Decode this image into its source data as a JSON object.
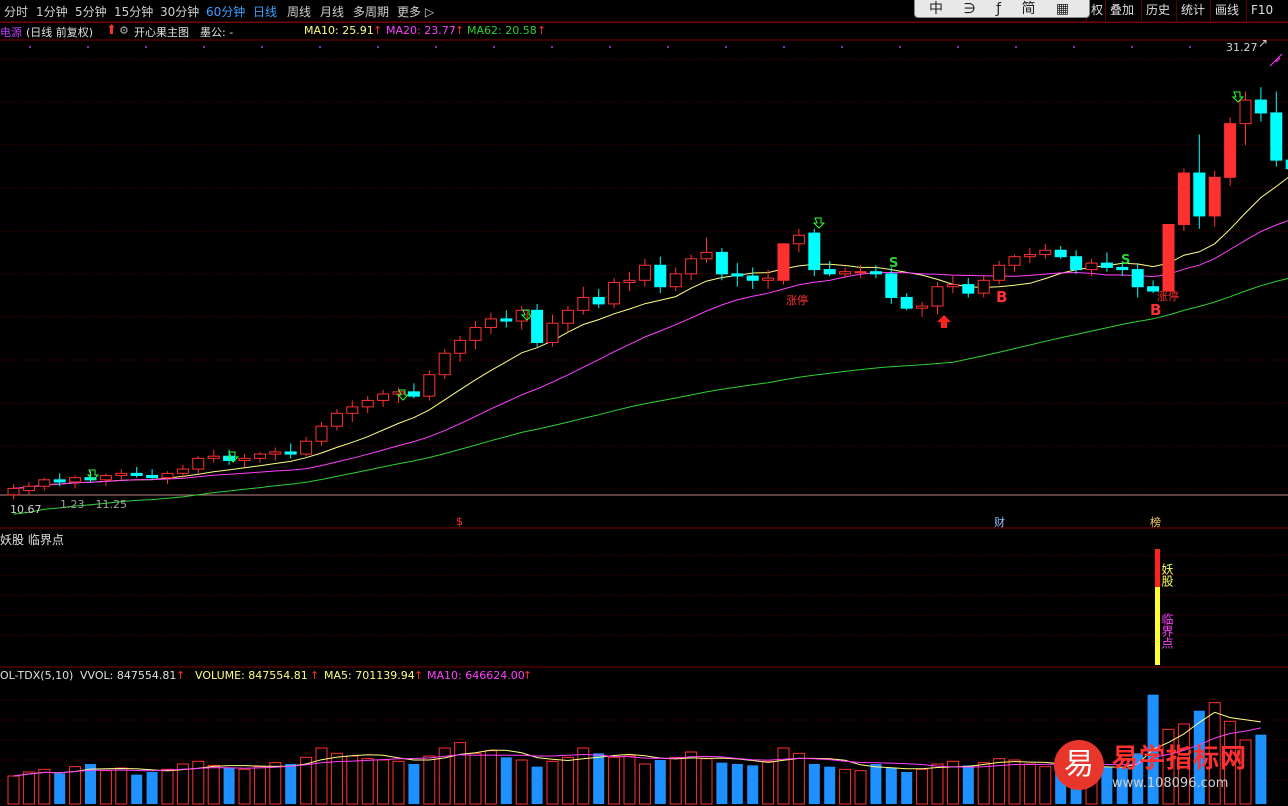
{
  "toolbar": {
    "periods": [
      "分时",
      "1分钟",
      "5分钟",
      "15分钟",
      "30分钟",
      "60分钟",
      "日线",
      "周线",
      "月线",
      "多周期",
      "更多 ▷"
    ],
    "active_index": 6,
    "right_buttons": [
      "权",
      "叠加",
      "历史",
      "统计",
      "画线",
      "F10"
    ],
    "popup_text": "中 ∋ ƒ 简 ▦"
  },
  "main_info": {
    "stock_name": "电源",
    "mode": "(日线 前复权)",
    "indicator_name": "开心果主图",
    "extra": "墨公: -",
    "ma10": "MA10: 25.91",
    "ma20": "MA20: 23.77",
    "ma62": "MA62: 20.58",
    "arrow_glyph": "↑"
  },
  "price_labels": {
    "high": "31.27",
    "low": "10.67",
    "range_note": "1.23 - 11.25"
  },
  "chart_markers": {
    "zt1": "涨停",
    "zt2": "涨停",
    "b1": "B",
    "b2": "B",
    "s1": "S",
    "s2": "S",
    "bottom_s": "$",
    "cai": "财",
    "bang": "榜"
  },
  "yaogu_panel": {
    "title": "妖股 临界点",
    "label_top": "妖股",
    "label_bottom": "临界点"
  },
  "volume_info": {
    "name": "OL-TDX(5,10)",
    "vvol": "VVOL: 847554.81",
    "volume": "VOLUME: 847554.81",
    "ma5": "MA5: 701139.94",
    "ma10": "MA10: 646624.00"
  },
  "watermark": {
    "logo": "易",
    "text": "易学指标网",
    "url": "www.108096.com"
  },
  "colors": {
    "up": "#ff3030",
    "down": "#00ffff",
    "ma10": "#ffff80",
    "ma20": "#ff40ff",
    "ma62": "#30d030",
    "volume_down": "#1e90ff",
    "grid": "#7a0000"
  },
  "chart_data": {
    "type": "candlestick",
    "x_count": 82,
    "ylim": [
      10.0,
      32.0
    ],
    "candles": [
      {
        "o": 10.8,
        "h": 11.3,
        "l": 10.6,
        "c": 11.1
      },
      {
        "o": 11.0,
        "h": 11.4,
        "l": 10.8,
        "c": 11.2
      },
      {
        "o": 11.2,
        "h": 11.6,
        "l": 11.0,
        "c": 11.5
      },
      {
        "o": 11.5,
        "h": 11.8,
        "l": 11.2,
        "c": 11.4
      },
      {
        "o": 11.4,
        "h": 11.7,
        "l": 11.1,
        "c": 11.6
      },
      {
        "o": 11.6,
        "h": 11.9,
        "l": 11.4,
        "c": 11.5
      },
      {
        "o": 11.5,
        "h": 11.8,
        "l": 11.2,
        "c": 11.7
      },
      {
        "o": 11.7,
        "h": 12.0,
        "l": 11.5,
        "c": 11.8
      },
      {
        "o": 11.8,
        "h": 12.1,
        "l": 11.6,
        "c": 11.7
      },
      {
        "o": 11.7,
        "h": 12.0,
        "l": 11.5,
        "c": 11.6
      },
      {
        "o": 11.6,
        "h": 11.9,
        "l": 11.3,
        "c": 11.8
      },
      {
        "o": 11.8,
        "h": 12.2,
        "l": 11.6,
        "c": 12.0
      },
      {
        "o": 12.0,
        "h": 12.6,
        "l": 11.8,
        "c": 12.5
      },
      {
        "o": 12.5,
        "h": 12.9,
        "l": 12.3,
        "c": 12.6
      },
      {
        "o": 12.6,
        "h": 12.9,
        "l": 12.2,
        "c": 12.4
      },
      {
        "o": 12.4,
        "h": 12.7,
        "l": 12.1,
        "c": 12.5
      },
      {
        "o": 12.5,
        "h": 12.8,
        "l": 12.3,
        "c": 12.7
      },
      {
        "o": 12.7,
        "h": 13.0,
        "l": 12.4,
        "c": 12.8
      },
      {
        "o": 12.8,
        "h": 13.2,
        "l": 12.5,
        "c": 12.7
      },
      {
        "o": 12.7,
        "h": 13.5,
        "l": 12.6,
        "c": 13.3
      },
      {
        "o": 13.3,
        "h": 14.2,
        "l": 13.1,
        "c": 14.0
      },
      {
        "o": 14.0,
        "h": 14.8,
        "l": 13.8,
        "c": 14.6
      },
      {
        "o": 14.6,
        "h": 15.2,
        "l": 14.2,
        "c": 14.9
      },
      {
        "o": 14.9,
        "h": 15.4,
        "l": 14.6,
        "c": 15.2
      },
      {
        "o": 15.2,
        "h": 15.7,
        "l": 14.9,
        "c": 15.5
      },
      {
        "o": 15.5,
        "h": 15.8,
        "l": 15.1,
        "c": 15.6
      },
      {
        "o": 15.6,
        "h": 16.0,
        "l": 15.3,
        "c": 15.4
      },
      {
        "o": 15.4,
        "h": 16.6,
        "l": 15.2,
        "c": 16.4
      },
      {
        "o": 16.4,
        "h": 17.6,
        "l": 16.2,
        "c": 17.4
      },
      {
        "o": 17.4,
        "h": 18.2,
        "l": 17.0,
        "c": 18.0
      },
      {
        "o": 18.0,
        "h": 18.9,
        "l": 17.6,
        "c": 18.6
      },
      {
        "o": 18.6,
        "h": 19.3,
        "l": 18.3,
        "c": 19.0
      },
      {
        "o": 19.0,
        "h": 19.4,
        "l": 18.6,
        "c": 18.9
      },
      {
        "o": 18.9,
        "h": 19.6,
        "l": 18.5,
        "c": 19.4
      },
      {
        "o": 19.4,
        "h": 19.7,
        "l": 17.7,
        "c": 17.9
      },
      {
        "o": 17.9,
        "h": 19.2,
        "l": 17.7,
        "c": 18.8
      },
      {
        "o": 18.8,
        "h": 19.6,
        "l": 18.4,
        "c": 19.4
      },
      {
        "o": 19.4,
        "h": 20.5,
        "l": 19.2,
        "c": 20.0
      },
      {
        "o": 20.0,
        "h": 20.4,
        "l": 19.5,
        "c": 19.7
      },
      {
        "o": 19.7,
        "h": 20.9,
        "l": 19.5,
        "c": 20.7
      },
      {
        "o": 20.7,
        "h": 21.2,
        "l": 20.3,
        "c": 20.8
      },
      {
        "o": 20.8,
        "h": 21.8,
        "l": 20.5,
        "c": 21.5
      },
      {
        "o": 21.5,
        "h": 21.9,
        "l": 20.2,
        "c": 20.5
      },
      {
        "o": 20.5,
        "h": 21.4,
        "l": 20.3,
        "c": 21.1
      },
      {
        "o": 21.1,
        "h": 22.0,
        "l": 20.8,
        "c": 21.8
      },
      {
        "o": 21.8,
        "h": 22.8,
        "l": 21.6,
        "c": 22.1
      },
      {
        "o": 22.1,
        "h": 22.3,
        "l": 20.8,
        "c": 21.1
      },
      {
        "o": 21.1,
        "h": 21.6,
        "l": 20.5,
        "c": 21.0
      },
      {
        "o": 21.0,
        "h": 21.4,
        "l": 20.4,
        "c": 20.8
      },
      {
        "o": 20.8,
        "h": 21.3,
        "l": 20.4,
        "c": 20.9
      },
      {
        "o": 20.8,
        "h": 22.5,
        "l": 20.6,
        "c": 22.5
      },
      {
        "o": 22.5,
        "h": 23.2,
        "l": 22.1,
        "c": 22.9
      },
      {
        "o": 23.0,
        "h": 23.2,
        "l": 21.0,
        "c": 21.3
      },
      {
        "o": 21.3,
        "h": 21.7,
        "l": 21.0,
        "c": 21.1
      },
      {
        "o": 21.1,
        "h": 21.4,
        "l": 20.9,
        "c": 21.2
      },
      {
        "o": 21.2,
        "h": 21.5,
        "l": 20.9,
        "c": 21.2
      },
      {
        "o": 21.2,
        "h": 21.5,
        "l": 20.9,
        "c": 21.1
      },
      {
        "o": 21.1,
        "h": 21.4,
        "l": 19.7,
        "c": 20.0
      },
      {
        "o": 20.0,
        "h": 20.2,
        "l": 19.4,
        "c": 19.5
      },
      {
        "o": 19.5,
        "h": 19.8,
        "l": 19.1,
        "c": 19.6
      },
      {
        "o": 19.6,
        "h": 20.7,
        "l": 19.2,
        "c": 20.5
      },
      {
        "o": 20.5,
        "h": 21.0,
        "l": 20.2,
        "c": 20.6
      },
      {
        "o": 20.6,
        "h": 20.9,
        "l": 20.0,
        "c": 20.2
      },
      {
        "o": 20.2,
        "h": 21.0,
        "l": 20.0,
        "c": 20.8
      },
      {
        "o": 20.8,
        "h": 21.7,
        "l": 20.6,
        "c": 21.5
      },
      {
        "o": 21.5,
        "h": 22.0,
        "l": 21.2,
        "c": 21.9
      },
      {
        "o": 21.9,
        "h": 22.3,
        "l": 21.6,
        "c": 22.0
      },
      {
        "o": 22.0,
        "h": 22.5,
        "l": 21.8,
        "c": 22.2
      },
      {
        "o": 22.2,
        "h": 22.4,
        "l": 21.8,
        "c": 21.9
      },
      {
        "o": 21.9,
        "h": 22.2,
        "l": 21.1,
        "c": 21.3
      },
      {
        "o": 21.3,
        "h": 21.8,
        "l": 21.0,
        "c": 21.6
      },
      {
        "o": 21.6,
        "h": 22.1,
        "l": 21.2,
        "c": 21.4
      },
      {
        "o": 21.4,
        "h": 21.7,
        "l": 21.0,
        "c": 21.3
      },
      {
        "o": 21.3,
        "h": 21.6,
        "l": 20.0,
        "c": 20.5
      },
      {
        "o": 20.5,
        "h": 20.8,
        "l": 20.2,
        "c": 20.3
      },
      {
        "o": 20.3,
        "h": 23.4,
        "l": 20.3,
        "c": 23.4
      },
      {
        "o": 23.4,
        "h": 26.0,
        "l": 23.1,
        "c": 25.8
      },
      {
        "o": 25.8,
        "h": 27.6,
        "l": 23.2,
        "c": 23.8
      },
      {
        "o": 23.8,
        "h": 25.9,
        "l": 23.3,
        "c": 25.6
      },
      {
        "o": 25.6,
        "h": 28.4,
        "l": 25.2,
        "c": 28.1
      },
      {
        "o": 28.1,
        "h": 29.6,
        "l": 27.1,
        "c": 29.2
      },
      {
        "o": 29.2,
        "h": 29.8,
        "l": 28.2,
        "c": 28.6
      },
      {
        "o": 28.6,
        "h": 29.6,
        "l": 26.1,
        "c": 26.4
      },
      {
        "o": 26.4,
        "h": 26.9,
        "l": 25.9,
        "c": 26.0
      }
    ],
    "final_candle": {
      "o": 26.0,
      "h": 31.27,
      "l": 25.9,
      "c": 30.9
    },
    "volume": [
      210,
      240,
      260,
      230,
      280,
      300,
      250,
      270,
      220,
      240,
      260,
      300,
      320,
      290,
      270,
      260,
      280,
      310,
      300,
      350,
      420,
      380,
      360,
      340,
      330,
      320,
      300,
      360,
      420,
      460,
      380,
      400,
      350,
      330,
      280,
      320,
      350,
      420,
      380,
      350,
      360,
      300,
      330,
      350,
      390,
      340,
      310,
      300,
      290,
      320,
      420,
      380,
      300,
      280,
      260,
      250,
      300,
      270,
      240,
      260,
      300,
      320,
      290,
      310,
      340,
      330,
      300,
      280,
      260,
      270,
      300,
      280,
      270,
      380,
      820,
      560,
      600,
      700,
      760,
      620,
      480,
      520
    ],
    "volume_ylim": [
      0,
      900
    ]
  }
}
